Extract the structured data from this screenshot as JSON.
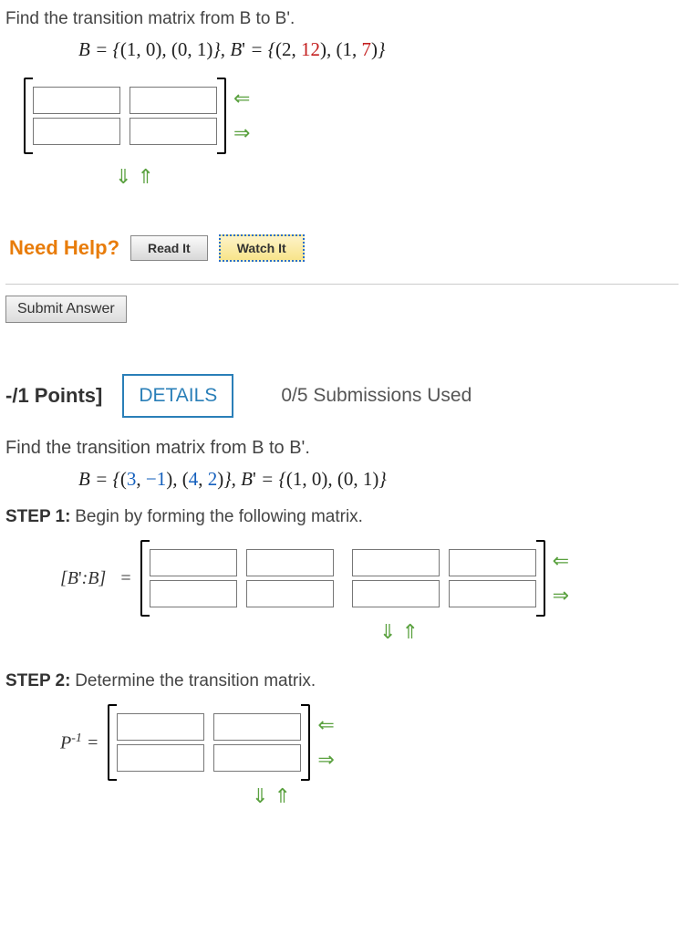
{
  "q1": {
    "prompt": "Find the transition matrix from B to B'.",
    "basis_label_B": "B",
    "basis_label_Bp": "B'",
    "eq": "=",
    "B_vecs": [
      "(1, 0)",
      "(0, 1)"
    ],
    "Bp_vecs": [
      "(2, 12)",
      "(1, 7)"
    ],
    "Bp_highlight": [
      false,
      true,
      false,
      true
    ]
  },
  "needhelp": {
    "label": "Need Help?",
    "read": "Read It",
    "watch": "Watch It"
  },
  "submit": "Submit Answer",
  "score": {
    "points": "-/1 Points]",
    "details": "DETAILS",
    "subs": "0/5 Submissions Used"
  },
  "q2": {
    "prompt": "Find the transition matrix from B to B'.",
    "B_vecs_html": "B = {(3, -1), (4, 2)}",
    "Bp_vecs_html": "B' = {(1, 0), (0, 1)}",
    "step1_label": "STEP 1:",
    "step1_text": " Begin by forming the following matrix.",
    "step1_matrix_label": "[B':B] =",
    "step2_label": "STEP 2:",
    "step2_text": " Determine the transition matrix.",
    "step2_matrix_label_P": "P",
    "step2_matrix_label_exp": "-1",
    "step2_matrix_label_eq": " ="
  }
}
